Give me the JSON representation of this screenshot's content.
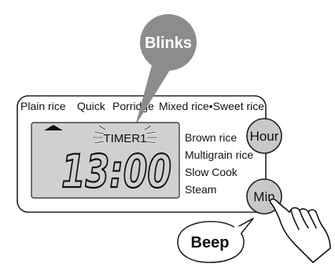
{
  "callout": {
    "text": "Blinks",
    "color": "#8c8c8c"
  },
  "menu": {
    "items": [
      "Plain rice",
      "Quick",
      "Porridge",
      "Mixed rice•Sweet rice"
    ]
  },
  "display": {
    "timer_label": "TIMER1",
    "time": "13:00",
    "screen_color": "#d0d0d0"
  },
  "side_menu": {
    "items": [
      "Brown rice",
      "Multigrain rice",
      "Slow Cook",
      "Steam"
    ]
  },
  "buttons": {
    "hour": {
      "label": "Hour",
      "color": "#c8c8c8"
    },
    "min": {
      "label": "Min",
      "color": "#c8c8c8"
    }
  },
  "sound": {
    "text": "Beep"
  },
  "icons": [
    "triangle-up-icon",
    "blink-rays-icon",
    "hand-pointer-icon"
  ]
}
